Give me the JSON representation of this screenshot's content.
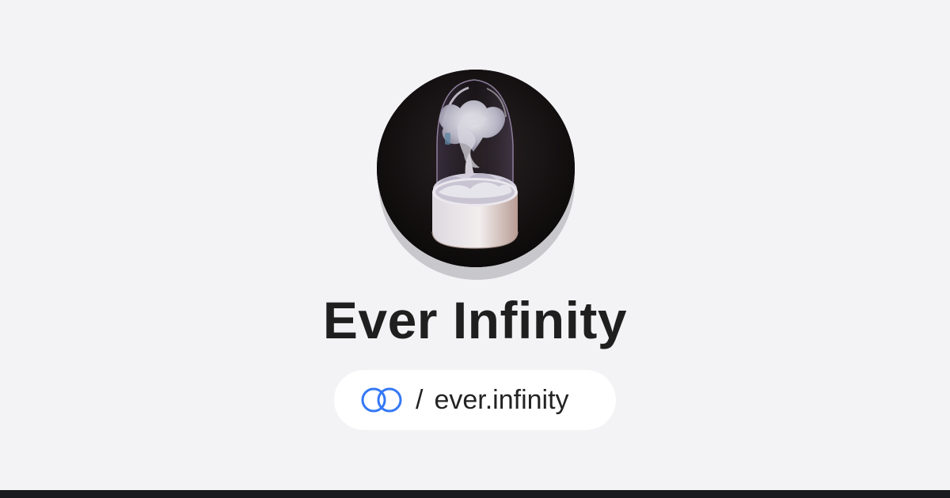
{
  "profile": {
    "name": "Ever Infinity",
    "slash": "/",
    "handle": "ever.infinity"
  },
  "colors": {
    "background": "#f3f3f5",
    "title": "#1f1f1f",
    "pill": "#ffffff",
    "logo": "#3478f6",
    "footer": "#18191c"
  },
  "icons": {
    "avatar": "tornado-bell-jar-avatar",
    "logo": "linked-rings-logo-icon"
  }
}
